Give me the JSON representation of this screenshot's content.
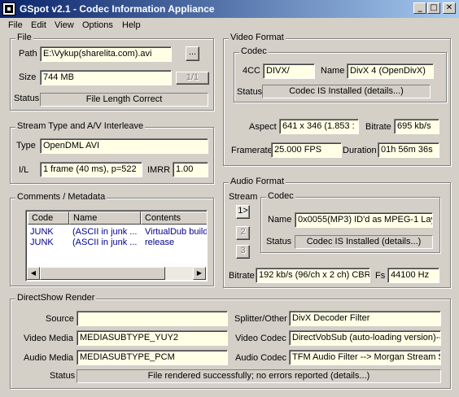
{
  "window": {
    "title": "GSpot v2.1 - Codec Information Appliance",
    "minimize_glyph": "_",
    "maximize_glyph": "□",
    "close_glyph": "✕"
  },
  "menu": [
    "File",
    "Edit",
    "View",
    "Options",
    "Help"
  ],
  "file": {
    "group_label": "File",
    "path_label": "Path",
    "path_value": "E:\\Vykup(sharelita.com).avi",
    "browse_label": "...",
    "size_label": "Size",
    "size_value": "744 MB",
    "page_button": "1/1",
    "status_label": "Status",
    "status_value": "File Length Correct"
  },
  "stream": {
    "group_label": "Stream Type and A/V Interleave",
    "type_label": "Type",
    "type_value": "OpenDML AVI",
    "il_label": "I/L",
    "il_value": "1 frame (40 ms), p=522",
    "imrr_label": "IMRR",
    "imrr_value": "1.00"
  },
  "comments": {
    "group_label": "Comments / Metadata",
    "columns": [
      "Code",
      "Name",
      "Contents"
    ],
    "rows": [
      [
        "JUNK",
        "(ASCII in junk ...",
        "VirtualDub build"
      ],
      [
        "JUNK",
        "(ASCII in junk ...",
        "release"
      ]
    ],
    "scroll_left": "◀",
    "scroll_right": "▶"
  },
  "video": {
    "group_label": "Video Format",
    "codec_group_label": "Codec",
    "fourcc_label": "4CC",
    "fourcc_value": "DIVX/",
    "name_label": "Name",
    "name_value": "DivX 4 (OpenDivX)",
    "status_label": "Status",
    "status_value": "Codec IS Installed  (details...)",
    "aspect_label": "Aspect",
    "aspect_value": "641 x 346  (1.853 :",
    "bitrate_label": "Bitrate",
    "bitrate_value": "695 kb/s",
    "framerate_label": "Framerate",
    "framerate_value": "25.000 FPS",
    "duration_label": "Duration",
    "duration_value": "01h 56m 36s"
  },
  "audio": {
    "group_label": "Audio Format",
    "stream_label": "Stream",
    "stream_buttons": [
      "1>",
      "2",
      "3"
    ],
    "codec_group_label": "Codec",
    "name_label": "Name",
    "name_value": "0x0055(MP3) ID'd as MPEG-1 Lay",
    "status_label": "Status",
    "status_value": "Codec IS Installed  (details...)",
    "bitrate_label": "Bitrate",
    "bitrate_value": "192 kb/s (96/ch x 2 ch) CBR",
    "fs_label": "Fs",
    "fs_value": "44100 Hz"
  },
  "directshow": {
    "group_label": "DirectShow Render",
    "source_label": "Source",
    "source_value": "",
    "video_media_label": "Video Media",
    "video_media_value": "MEDIASUBTYPE_YUY2",
    "audio_media_label": "Audio Media",
    "audio_media_value": "MEDIASUBTYPE_PCM",
    "splitter_label": "Splitter/Other",
    "splitter_value": "DivX Decoder Filter",
    "video_codec_label": "Video Codec",
    "video_codec_value": "DirectVobSub (auto-loading version)-->",
    "audio_codec_label": "Audio Codec",
    "audio_codec_value": "TFM Audio Filter --> Morgan Stream S",
    "status_label": "Status",
    "status_value": "File rendered successfully; no errors reported   (details...)"
  }
}
